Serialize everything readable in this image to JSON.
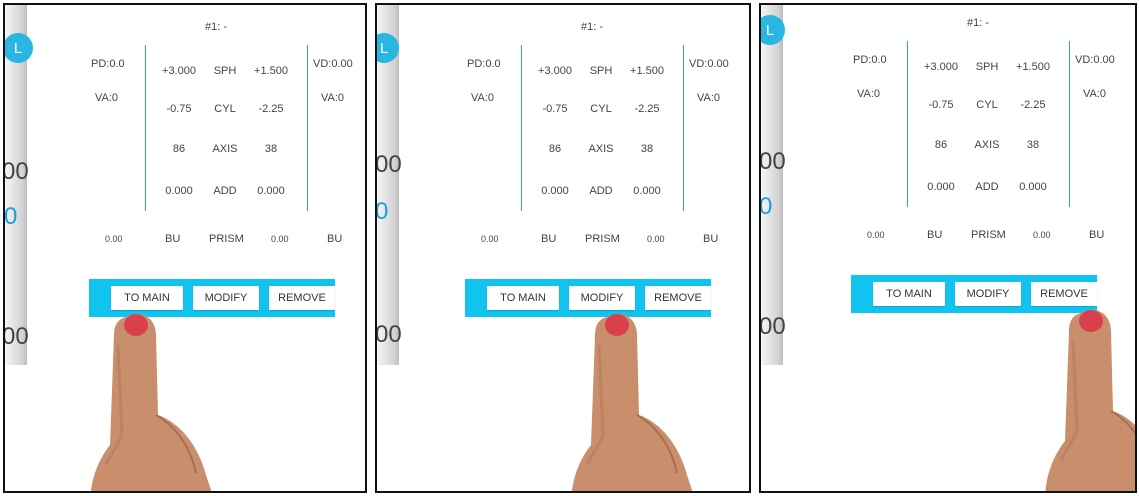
{
  "rx": {
    "title": "#1: -",
    "pd": "PD:0.0",
    "va_left": "VA:0",
    "vd": "VD:0.00",
    "va_right": "VA:0",
    "rows": [
      {
        "left": "+3.000",
        "label": "SPH",
        "right": "+1.500"
      },
      {
        "left": "-0.75",
        "label": "CYL",
        "right": "-2.25"
      },
      {
        "left": "86",
        "label": "AXIS",
        "right": "38"
      },
      {
        "left": "0.000",
        "label": "ADD",
        "right": "0.000"
      }
    ],
    "prism": {
      "left_value": "0.00",
      "left_base": "BU",
      "label": "PRISM",
      "right_value": "0.00",
      "right_base": "BU"
    }
  },
  "buttons": {
    "to_main": "TO MAIN",
    "modify": "MODIFY",
    "remove": "REMOVE"
  },
  "background": {
    "circle_letter": "L",
    "edge_1": "00",
    "edge_2": "0",
    "edge_3": "00"
  },
  "panels": [
    {
      "id": "panel-1",
      "tapped": "TO MAIN"
    },
    {
      "id": "panel-2",
      "tapped": "MODIFY"
    },
    {
      "id": "panel-3",
      "tapped": "REMOVE"
    }
  ],
  "colors": {
    "accent": "#11c3ef",
    "divider": "#2aa1d8",
    "nail": "#d9404b",
    "skin": "#c98f6c"
  }
}
